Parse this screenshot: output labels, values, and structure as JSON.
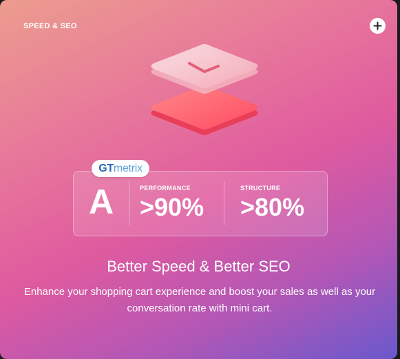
{
  "card": {
    "section_label": "SPEED & SEO",
    "plus_icon": "plus-icon"
  },
  "illustration": {
    "icon": "clock-stack-icon"
  },
  "stats": {
    "badge_text_gt": "GT",
    "badge_text_metrix": "metrix",
    "grade": "A",
    "performance_label": "PERFORMANCE",
    "performance_value": ">90%",
    "structure_label": "STRUCTURE",
    "structure_value": ">80%"
  },
  "headline": "Better Speed & Better SEO",
  "description": "Enhance your shopping cart experience and boost your sales as well as your conversation rate with mini cart.",
  "colors": {
    "gradient_start": "#ec9c8e",
    "gradient_mid": "#df5a9f",
    "gradient_end": "#6a58cc",
    "tile_top": "#f7b8c4",
    "tile_bottom": "#ff5a6e"
  }
}
